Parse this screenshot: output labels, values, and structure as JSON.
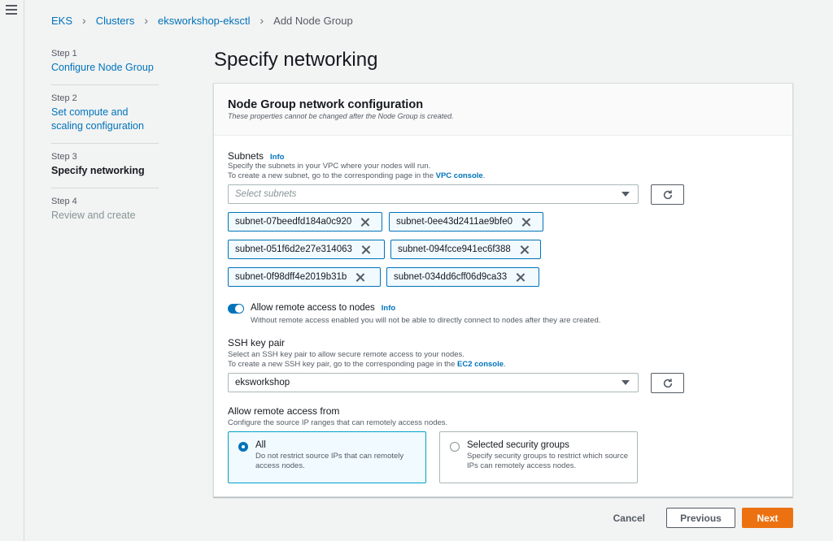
{
  "breadcrumb": [
    "EKS",
    "Clusters",
    "eksworkshop-eksctl",
    "Add Node Group"
  ],
  "steps": [
    {
      "num": "Step 1",
      "title": "Configure Node Group"
    },
    {
      "num": "Step 2",
      "title": "Set compute and scaling configuration"
    },
    {
      "num": "Step 3",
      "title": "Specify networking"
    },
    {
      "num": "Step 4",
      "title": "Review and create"
    }
  ],
  "page_title": "Specify networking",
  "panel": {
    "title": "Node Group network configuration",
    "subtitle": "These properties cannot be changed after the Node Group is created."
  },
  "subnets": {
    "label": "Subnets",
    "info": "Info",
    "desc1": "Specify the subnets in your VPC where your nodes will run.",
    "desc2": "To create a new subnet, go to the corresponding page in the",
    "desc2_link": "VPC console",
    "placeholder": "Select subnets",
    "tokens": [
      "subnet-07beedfd184a0c920",
      "subnet-0ee43d2411ae9bfe0",
      "subnet-051f6d2e27e314063",
      "subnet-094fcce941ec6f388",
      "subnet-0f98dff4e2019b31b",
      "subnet-034dd6cff06d9ca33"
    ]
  },
  "remote_access": {
    "label": "Allow remote access to nodes",
    "info": "Info",
    "enabled": true,
    "desc": "Without remote access enabled you will not be able to directly connect to nodes after they are created."
  },
  "ssh": {
    "label": "SSH key pair",
    "desc1": "Select an SSH key pair to allow secure remote access to your nodes.",
    "desc2": "To create a new SSH key pair, go to the corresponding page in the",
    "desc2_link": "EC2 console",
    "value": "eksworkshop"
  },
  "remote_from": {
    "label": "Allow remote access from",
    "desc": "Configure the source IP ranges that can remotely access nodes.",
    "options": [
      {
        "title": "All",
        "desc": "Do not restrict source IPs that can remotely access nodes.",
        "selected": true
      },
      {
        "title": "Selected security groups",
        "desc": "Specify security groups to restrict which source IPs can remotely access nodes.",
        "selected": false
      }
    ]
  },
  "footer": {
    "cancel": "Cancel",
    "previous": "Previous",
    "next": "Next"
  }
}
